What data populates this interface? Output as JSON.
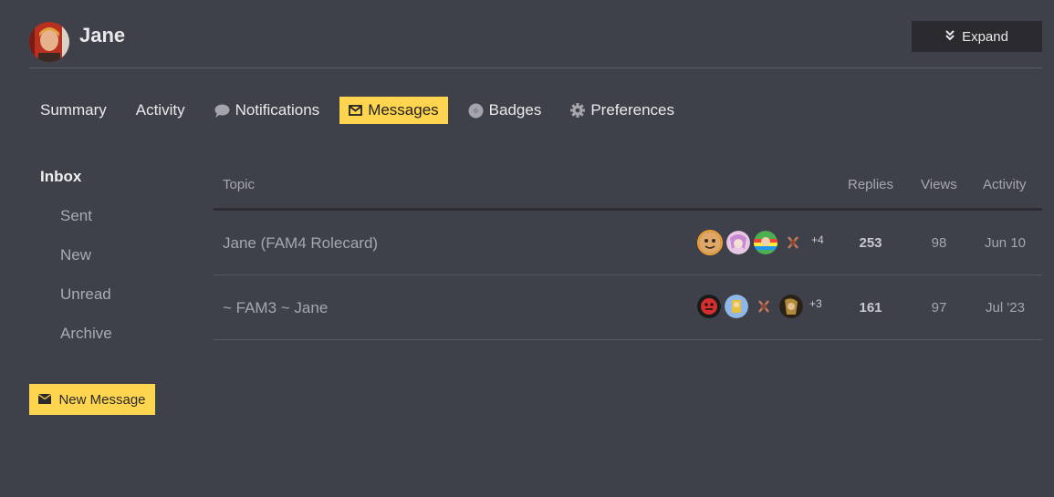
{
  "user": {
    "name": "Jane"
  },
  "header": {
    "expand_label": "Expand"
  },
  "nav": {
    "summary": "Summary",
    "activity": "Activity",
    "notifications": "Notifications",
    "messages": "Messages",
    "badges": "Badges",
    "preferences": "Preferences"
  },
  "sidebar": {
    "inbox": "Inbox",
    "sent": "Sent",
    "new": "New",
    "unread": "Unread",
    "archive": "Archive",
    "new_message_button": "New Message"
  },
  "table": {
    "headers": {
      "topic": "Topic",
      "replies": "Replies",
      "views": "Views",
      "activity": "Activity"
    },
    "rows": [
      {
        "title": "Jane (FAM4 Rolecard)",
        "more_posters": "+4",
        "replies": "253",
        "views": "98",
        "activity": "Jun 10"
      },
      {
        "title": "~ FAM3 ~ Jane",
        "more_posters": "+3",
        "replies": "161",
        "views": "97",
        "activity": "Jul '23"
      }
    ]
  },
  "colors": {
    "accent": "#ffd44e",
    "background": "#3e404a",
    "button_dark": "#2b2b2f"
  }
}
